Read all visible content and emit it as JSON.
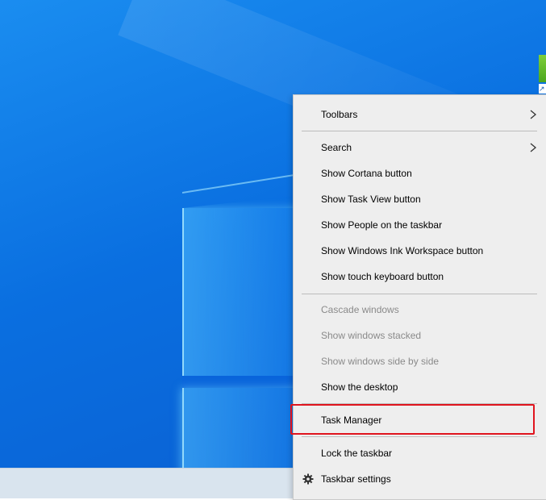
{
  "desktop": {
    "wallpaper_color": "#0a6fe0",
    "taskbar_color": "#d9e4ee"
  },
  "menu": {
    "items": [
      {
        "label": "Toolbars",
        "submenu": true,
        "disabled": false
      },
      {
        "label": "Search",
        "submenu": true,
        "disabled": false
      },
      {
        "label": "Show Cortana button",
        "submenu": false,
        "disabled": false
      },
      {
        "label": "Show Task View button",
        "submenu": false,
        "disabled": false
      },
      {
        "label": "Show People on the taskbar",
        "submenu": false,
        "disabled": false
      },
      {
        "label": "Show Windows Ink Workspace button",
        "submenu": false,
        "disabled": false
      },
      {
        "label": "Show touch keyboard button",
        "submenu": false,
        "disabled": false
      },
      {
        "label": "Cascade windows",
        "submenu": false,
        "disabled": true
      },
      {
        "label": "Show windows stacked",
        "submenu": false,
        "disabled": true
      },
      {
        "label": "Show windows side by side",
        "submenu": false,
        "disabled": true
      },
      {
        "label": "Show the desktop",
        "submenu": false,
        "disabled": false
      },
      {
        "label": "Task Manager",
        "submenu": false,
        "disabled": false,
        "highlighted": true
      },
      {
        "label": "Lock the taskbar",
        "submenu": false,
        "disabled": false
      },
      {
        "label": "Taskbar settings",
        "submenu": false,
        "disabled": false,
        "icon": "gear-icon"
      }
    ],
    "highlight_color": "#e0141e",
    "disabled_text_color": "#8a8a8a"
  }
}
